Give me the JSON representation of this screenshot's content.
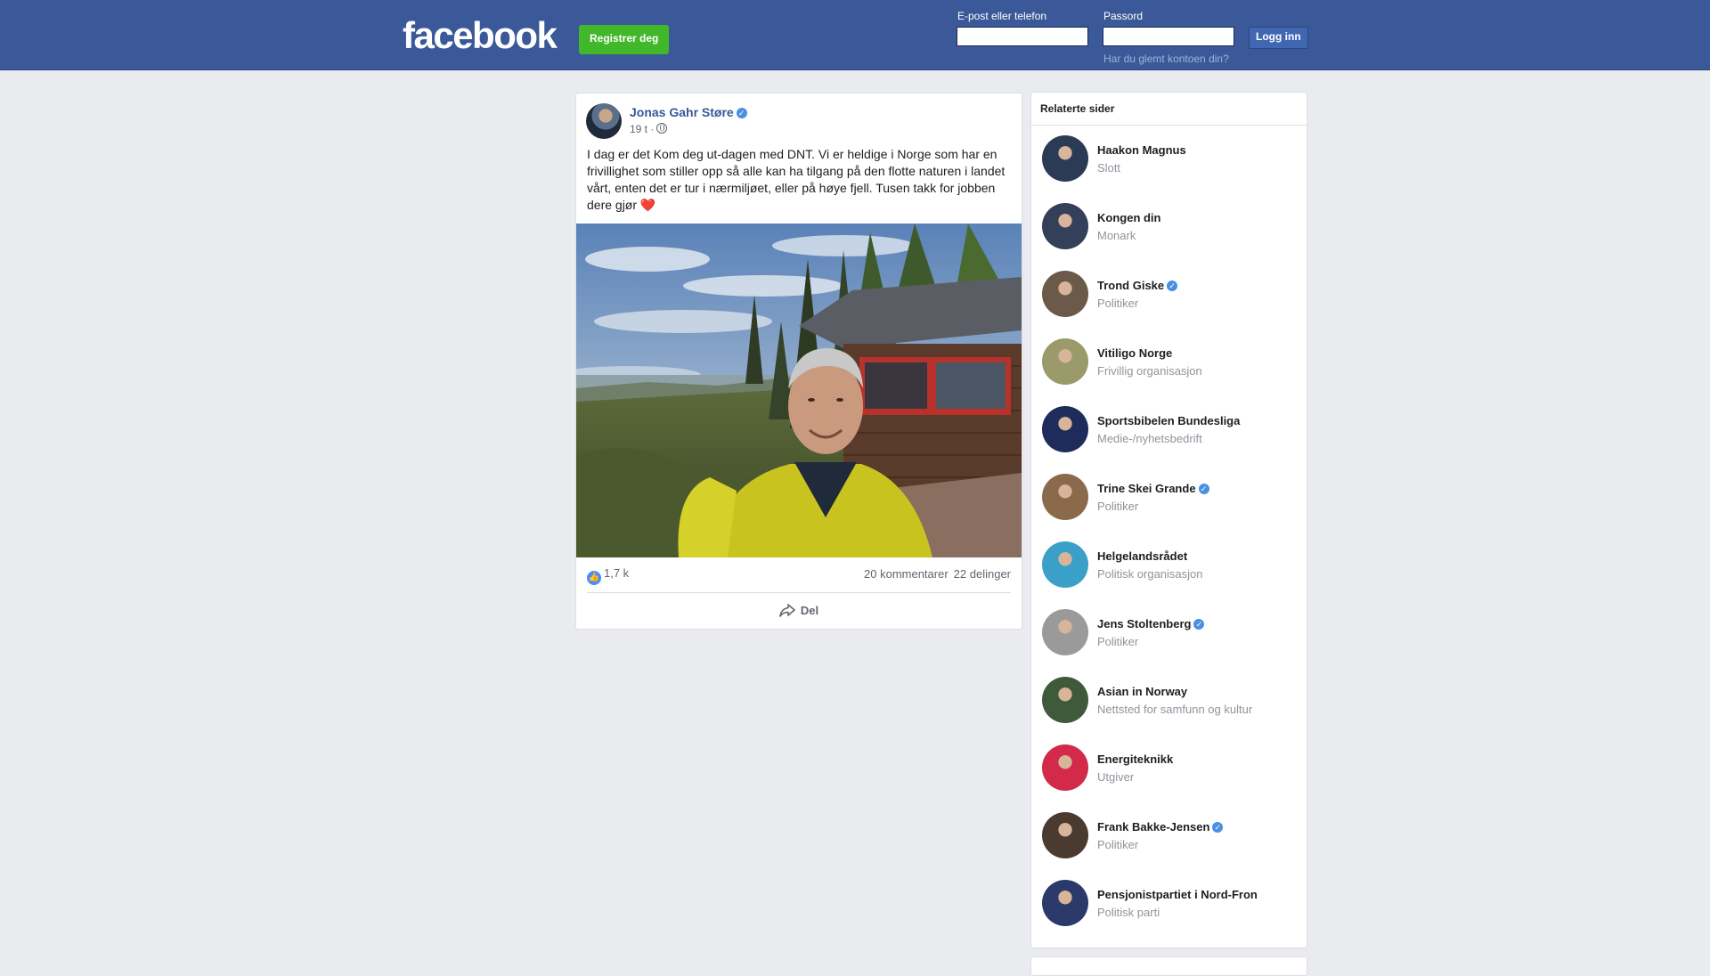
{
  "header": {
    "logo": "facebook",
    "register_label": "Registrer deg",
    "email_label": "E-post eller telefon",
    "password_label": "Passord",
    "login_label": "Logg inn",
    "forgot_label": "Har du glemt kontoen din?"
  },
  "post": {
    "author": "Jonas Gahr Støre",
    "time": "19 t ·",
    "text": "I dag er det Kom deg ut-dagen med DNT. Vi er heldige i Norge som har en frivillighet som stiller opp så alle kan ha tilgang på den flotte naturen i landet vårt, enten det er tur i nærmiljøet, eller på høye fjell. Tusen takk for jobben dere gjør",
    "heart": "❤️",
    "likes": "1,7 k",
    "comments": "20 kommentarer",
    "shares": "22 delinger",
    "share_label": "Del"
  },
  "related": {
    "title": "Relaterte sider",
    "items": [
      {
        "name": "Haakon Magnus",
        "category": "Slott",
        "verified": false,
        "avatar_color": "#2b3b55"
      },
      {
        "name": "Kongen din",
        "category": "Monark",
        "verified": false,
        "avatar_color": "#34405a"
      },
      {
        "name": "Trond Giske",
        "category": "Politiker",
        "verified": true,
        "avatar_color": "#6b5a4a"
      },
      {
        "name": "Vitiligo Norge",
        "category": "Frivillig organisasjon",
        "verified": false,
        "avatar_color": "#9a9a6a"
      },
      {
        "name": "Sportsbibelen Bundesliga",
        "category": "Medie-/nyhetsbedrift",
        "verified": false,
        "avatar_color": "#1d2c5a"
      },
      {
        "name": "Trine Skei Grande",
        "category": "Politiker",
        "verified": true,
        "avatar_color": "#8a6a4a"
      },
      {
        "name": "Helgelandsrådet",
        "category": "Politisk organisasjon",
        "verified": false,
        "avatar_color": "#3aa0c8"
      },
      {
        "name": "Jens Stoltenberg",
        "category": "Politiker",
        "verified": true,
        "avatar_color": "#9a9a9a"
      },
      {
        "name": "Asian in Norway",
        "category": "Nettsted for samfunn og kultur",
        "verified": false,
        "avatar_color": "#3f5a3a"
      },
      {
        "name": "Energiteknikk",
        "category": "Utgiver",
        "verified": false,
        "avatar_color": "#d42a4a"
      },
      {
        "name": "Frank Bakke-Jensen",
        "category": "Politiker",
        "verified": true,
        "avatar_color": "#4a3a30"
      },
      {
        "name": "Pensjonistpartiet i Nord-Fron",
        "category": "Politisk parti",
        "verified": false,
        "avatar_color": "#2b3a6a"
      }
    ]
  },
  "colors": {
    "brand": "#3b5998",
    "register_green": "#42b72a",
    "link": "#365899"
  }
}
